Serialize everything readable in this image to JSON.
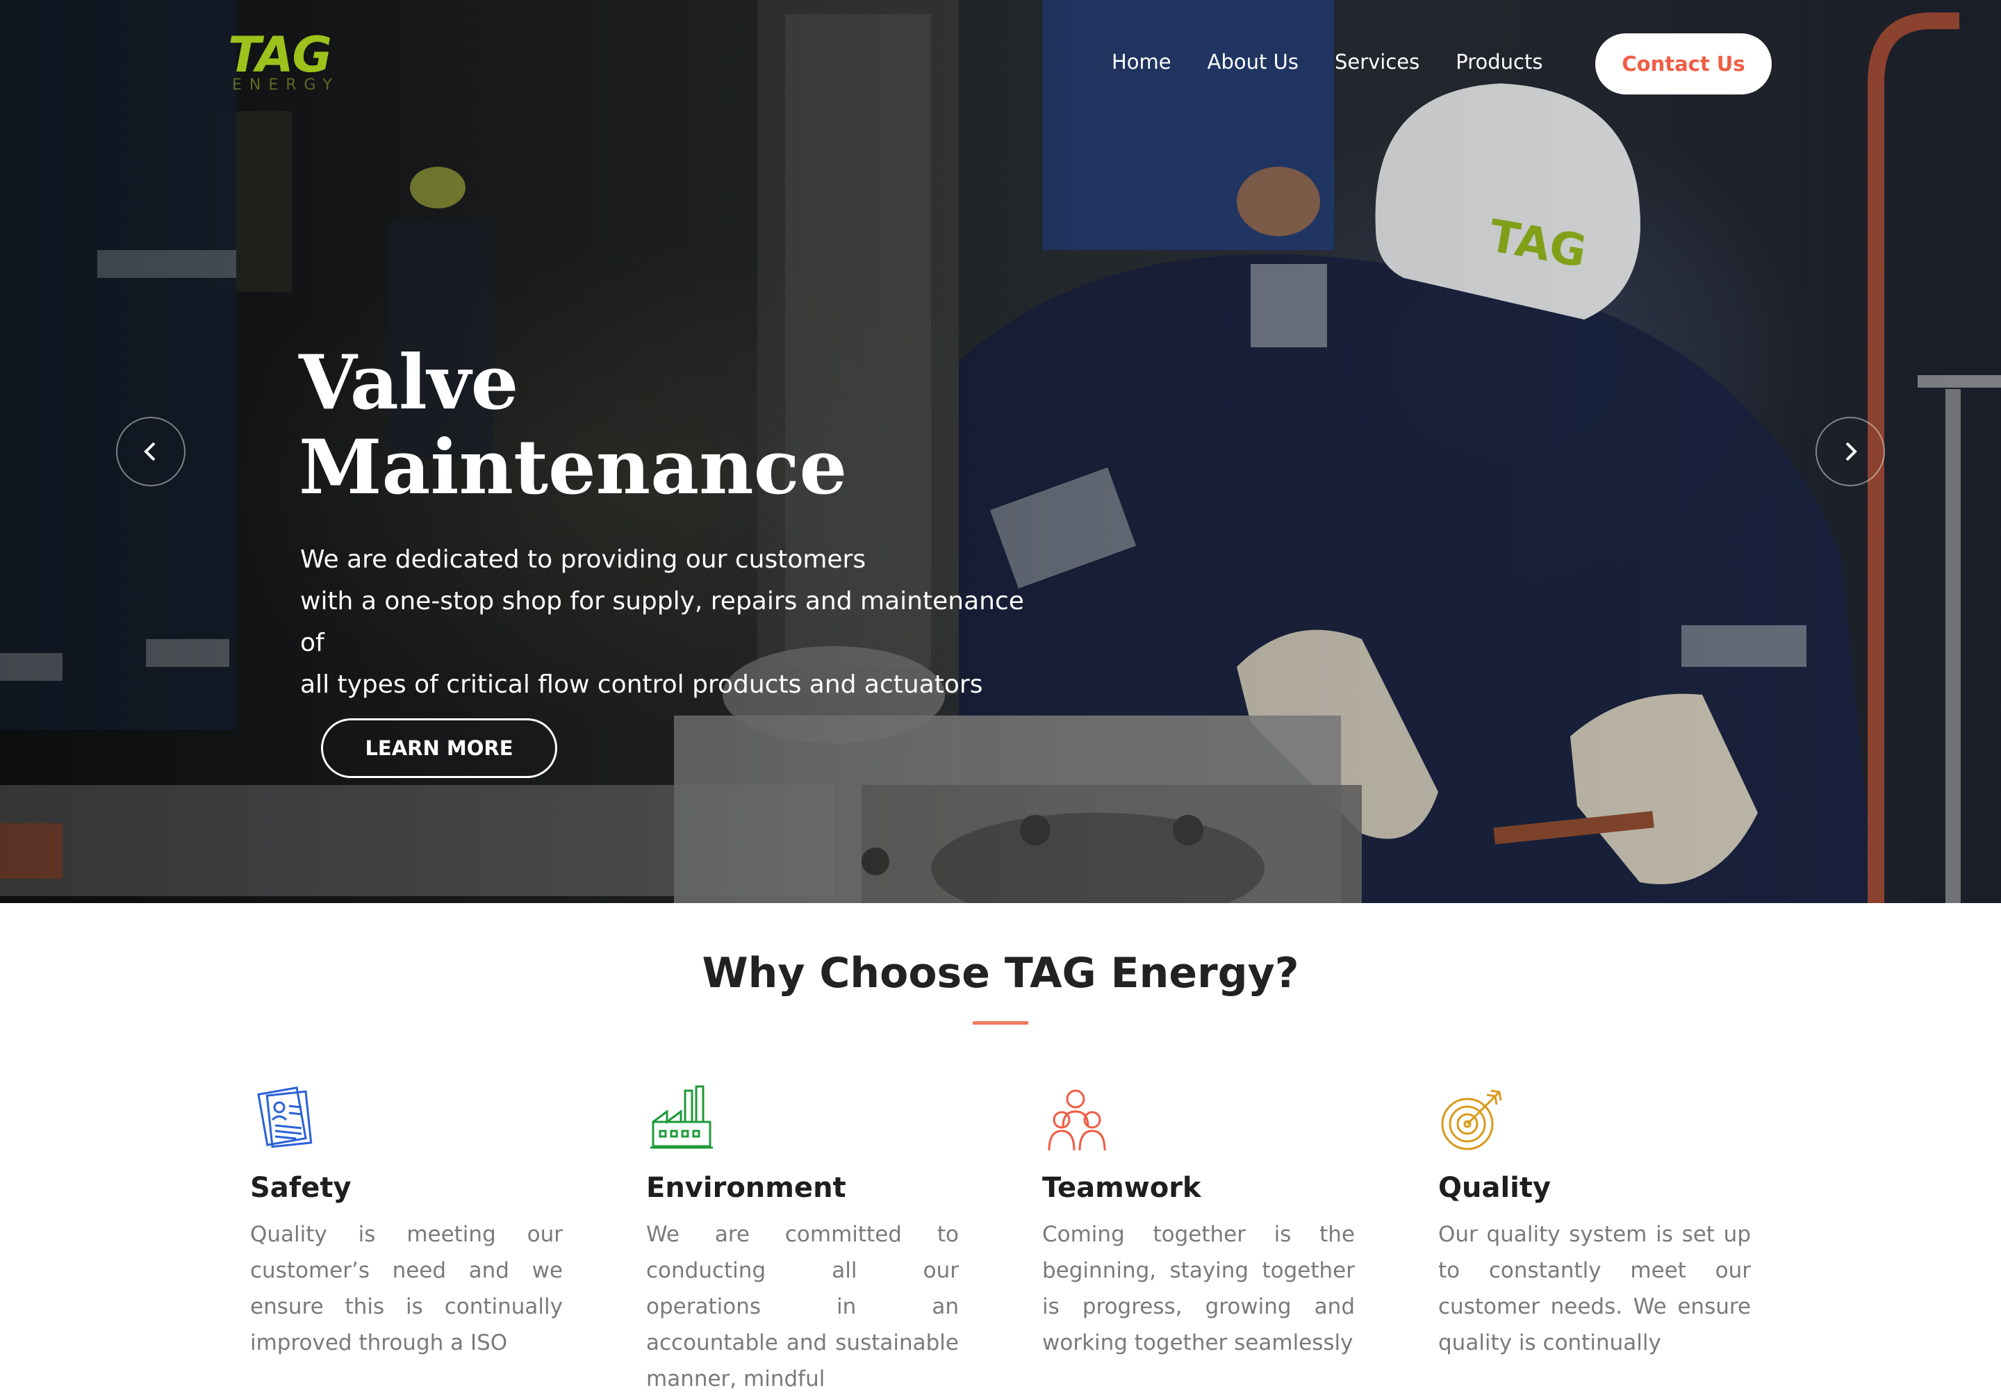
{
  "brand": {
    "logo_text": "TAG",
    "logo_sub": "ENERGY",
    "logo_color": "#9cc21b"
  },
  "nav": {
    "items": [
      {
        "label": "Home"
      },
      {
        "label": "About Us"
      },
      {
        "label": "Services"
      },
      {
        "label": "Products"
      }
    ],
    "contact_label": "Contact Us",
    "contact_color": "#ef5d45"
  },
  "hero": {
    "title_line1": "Valve",
    "title_line2": "Maintenance",
    "desc_line1": "We are dedicated to providing our customers",
    "desc_line2": "with a one-stop shop for supply, repairs and maintenance of",
    "desc_line3": "all types of critical flow control products and actuators",
    "cta_label": "LEARN MORE",
    "prev_icon": "chevron-left-icon",
    "next_icon": "chevron-right-icon"
  },
  "why": {
    "title": "Why Choose TAG Energy?",
    "accent_color": "#ef7b63",
    "features": [
      {
        "icon": "document-icon",
        "icon_color": "#2a62d6",
        "title": "Safety",
        "text": "Quality is meeting our customer’s need and we ensure this is continually improved through a ISO"
      },
      {
        "icon": "factory-icon",
        "icon_color": "#1f9a3a",
        "title": "Environment",
        "text": "We are committed to conducting all our operations in an accountable and sustainable manner, mindful"
      },
      {
        "icon": "team-icon",
        "icon_color": "#ef5d45",
        "title": "Teamwork",
        "text": "Coming together is the beginning, staying together is progress, growing and working together seamlessly"
      },
      {
        "icon": "target-icon",
        "icon_color": "#d99a1a",
        "title": "Quality",
        "text": "Our quality system is set up to constantly meet our customer needs. We ensure quality is continually"
      }
    ]
  }
}
